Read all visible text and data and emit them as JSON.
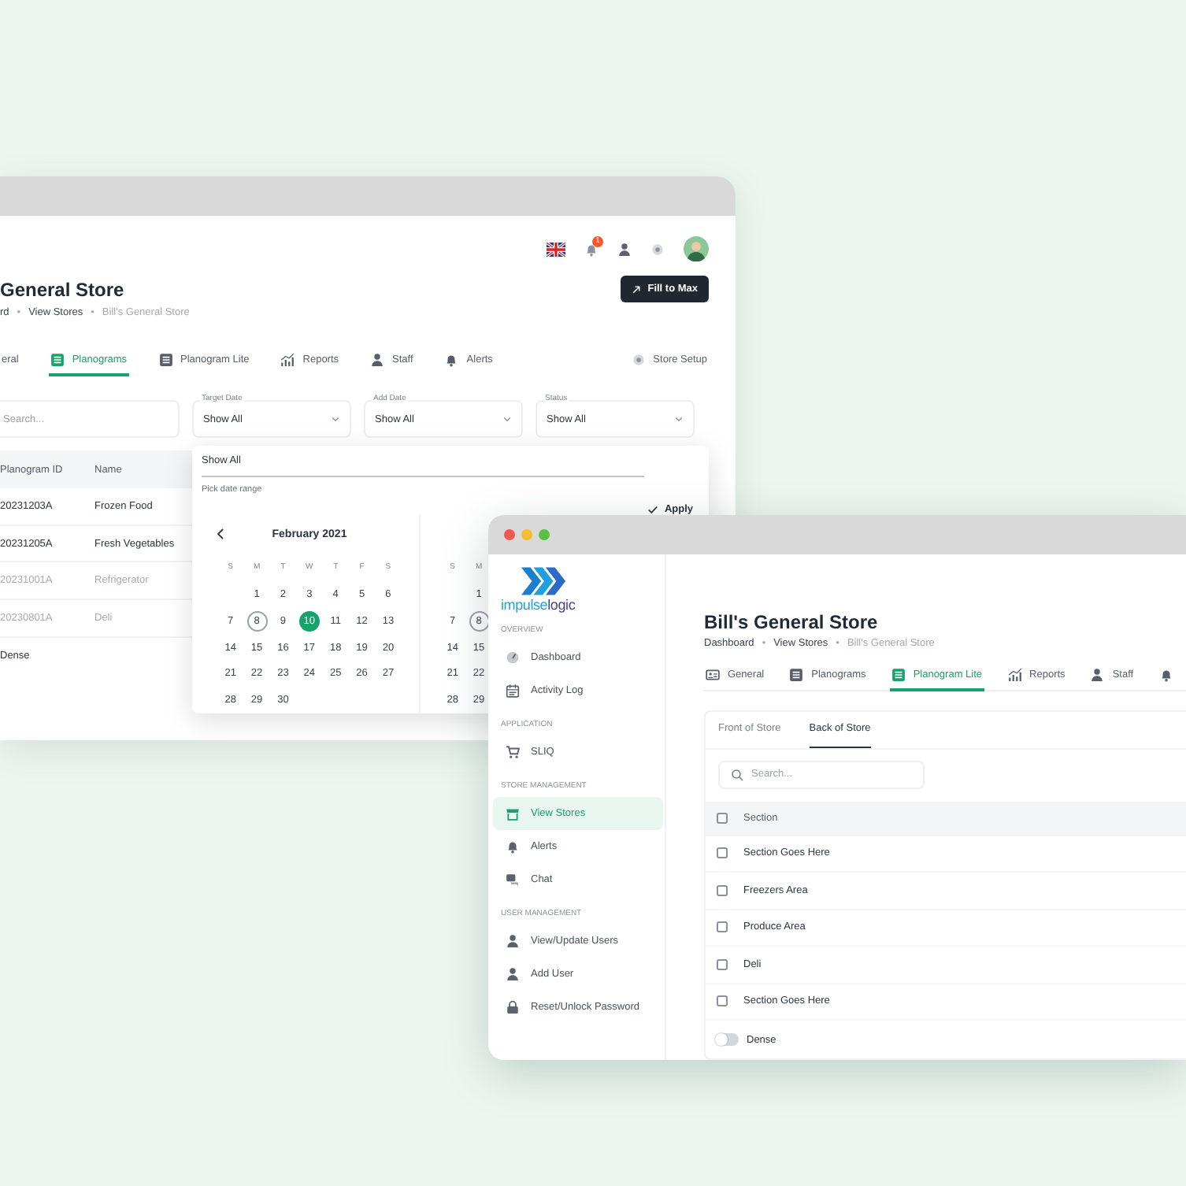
{
  "back_window": {
    "notification_count": "1",
    "title": "General Store",
    "fill_button": "Fill to Max",
    "breadcrumb": {
      "separator": "•",
      "items": [
        {
          "label": "rd",
          "current": false
        },
        {
          "label": "View Stores",
          "current": false
        },
        {
          "label": "Bill's General Store",
          "current": true
        }
      ]
    },
    "tabs": [
      {
        "label": "eral",
        "selected": false
      },
      {
        "label": "Planograms",
        "kind": "list",
        "selected": true
      },
      {
        "label": "Planogram Lite",
        "kind": "list",
        "selected": false
      },
      {
        "label": "Reports",
        "kind": "chart",
        "selected": false
      },
      {
        "label": "Staff",
        "kind": "person",
        "selected": false
      },
      {
        "label": "Alerts",
        "kind": "bell",
        "selected": false
      }
    ],
    "store_setup": "Store Setup",
    "search": {
      "placeholder": "Search..."
    },
    "filters": [
      {
        "label": "Target Date",
        "value": "Show All"
      },
      {
        "label": "Add Date",
        "value": "Show All"
      },
      {
        "label": "Status",
        "value": "Show All"
      }
    ],
    "table": {
      "columns": [
        "Planogram ID",
        "Name"
      ],
      "rows": [
        {
          "cells": [
            "20231203A",
            "Frozen Food"
          ],
          "muted": false
        },
        {
          "cells": [
            "20231205A",
            "Fresh Vegetables"
          ],
          "muted": false
        },
        {
          "cells": [
            "20231001A",
            "Refrigerator"
          ],
          "muted": true
        },
        {
          "cells": [
            "20230801A",
            "Deli"
          ],
          "muted": true
        }
      ]
    },
    "dense_label": "Dense",
    "date_popup": {
      "option": "Show All",
      "hint": "Pick date range",
      "apply": "Apply",
      "calendars": [
        {
          "month": "February 2021",
          "weekdays": [
            "S",
            "M",
            "T",
            "W",
            "T",
            "F",
            "S"
          ],
          "weeks": [
            {
              "days": [
                {
                  "day": "1",
                  "selected": false,
                  "today": false
                },
                {
                  "day": "2",
                  "selected": false,
                  "today": false
                },
                {
                  "day": "3",
                  "selected": false,
                  "today": false
                },
                {
                  "day": "4",
                  "selected": false,
                  "today": false
                },
                {
                  "day": "5",
                  "selected": false,
                  "today": false
                },
                {
                  "day": "6",
                  "selected": false,
                  "today": false
                }
              ]
            },
            {
              "days": [
                {
                  "day": "7",
                  "selected": false,
                  "today": false
                },
                {
                  "day": "8",
                  "selected": false,
                  "today": true
                },
                {
                  "day": "9",
                  "selected": false,
                  "today": false
                },
                {
                  "day": "10",
                  "selected": true,
                  "today": false
                },
                {
                  "day": "11",
                  "selected": false,
                  "today": false
                },
                {
                  "day": "12",
                  "selected": false,
                  "today": false
                },
                {
                  "day": "13",
                  "selected": false,
                  "today": false
                }
              ]
            },
            {
              "days": [
                {
                  "day": "14",
                  "selected": false,
                  "today": false
                },
                {
                  "day": "15",
                  "selected": false,
                  "today": false
                },
                {
                  "day": "16",
                  "selected": false,
                  "today": false
                },
                {
                  "day": "17",
                  "selected": false,
                  "today": false
                },
                {
                  "day": "18",
                  "selected": false,
                  "today": false
                },
                {
                  "day": "19",
                  "selected": false,
                  "today": false
                },
                {
                  "day": "20",
                  "selected": false,
                  "today": false
                }
              ]
            },
            {
              "days": [
                {
                  "day": "21",
                  "selected": false,
                  "today": false
                },
                {
                  "day": "22",
                  "selected": false,
                  "today": false
                },
                {
                  "day": "23",
                  "selected": false,
                  "today": false
                },
                {
                  "day": "24",
                  "selected": false,
                  "today": false
                },
                {
                  "day": "25",
                  "selected": false,
                  "today": false
                },
                {
                  "day": "26",
                  "selected": false,
                  "today": false
                },
                {
                  "day": "27",
                  "selected": false,
                  "today": false
                }
              ]
            },
            {
              "days": [
                {
                  "day": "28",
                  "selected": false,
                  "today": false
                },
                {
                  "day": "29",
                  "selected": false,
                  "today": false
                },
                {
                  "day": "30",
                  "selected": false,
                  "today": false
                }
              ]
            }
          ]
        },
        {
          "weekdays": [
            "S",
            "M"
          ],
          "weeks": [
            {
              "days": [
                {
                  "day": "1",
                  "selected": false,
                  "today": false
                }
              ]
            },
            {
              "days": [
                {
                  "day": "7",
                  "selected": false,
                  "today": false
                },
                {
                  "day": "8",
                  "selected": false,
                  "today": true
                }
              ]
            },
            {
              "days": [
                {
                  "day": "14",
                  "selected": false,
                  "today": false
                },
                {
                  "day": "15",
                  "selected": false,
                  "today": false
                }
              ]
            },
            {
              "days": [
                {
                  "day": "21",
                  "selected": false,
                  "today": false
                },
                {
                  "day": "22",
                  "selected": false,
                  "today": false
                }
              ]
            },
            {
              "days": [
                {
                  "day": "28",
                  "selected": false,
                  "today": false
                },
                {
                  "day": "29",
                  "selected": false,
                  "today": false
                }
              ]
            }
          ]
        }
      ]
    }
  },
  "front_window": {
    "logo": {
      "parts": [
        "impulse",
        "logic"
      ]
    },
    "sidebar": {
      "sections": [
        {
          "heading": "OVERVIEW",
          "items": [
            {
              "label": "Dashboard",
              "kind": "gauge",
              "selected": false
            },
            {
              "label": "Activity Log",
              "kind": "calendar",
              "selected": false
            }
          ]
        },
        {
          "heading": "APPLICATION",
          "items": [
            {
              "label": "SLIQ",
              "kind": "cart",
              "selected": false
            }
          ]
        },
        {
          "heading": "STORE MANAGEMENT",
          "items": [
            {
              "label": "View Stores",
              "kind": "store",
              "selected": true
            },
            {
              "label": "Alerts",
              "kind": "bell",
              "selected": false
            },
            {
              "label": "Chat",
              "kind": "chat",
              "selected": false
            }
          ]
        },
        {
          "heading": "USER MANAGEMENT",
          "items": [
            {
              "label": "View/Update Users",
              "kind": "person",
              "selected": false
            },
            {
              "label": "Add User",
              "kind": "person",
              "selected": false
            },
            {
              "label": "Reset/Unlock Password",
              "kind": "lock",
              "selected": false
            }
          ]
        }
      ]
    },
    "title": "Bill's General Store",
    "breadcrumb": {
      "separator": "•",
      "items": [
        {
          "label": "Dashboard",
          "current": false
        },
        {
          "label": "View Stores",
          "current": false
        },
        {
          "label": "Bill's General Store",
          "current": true
        }
      ]
    },
    "tabs": [
      {
        "label": "General",
        "kind": "card",
        "selected": false
      },
      {
        "label": "Planograms",
        "kind": "list",
        "selected": false
      },
      {
        "label": "Planogram Lite",
        "kind": "list",
        "selected": true
      },
      {
        "label": "Reports",
        "kind": "chart",
        "selected": false
      },
      {
        "label": "Staff",
        "kind": "person",
        "selected": false
      },
      {
        "kind": "bell",
        "selected": false
      }
    ],
    "subtabs": [
      {
        "label": "Front of Store",
        "selected": false
      },
      {
        "label": "Back of Store",
        "selected": true
      }
    ],
    "search": {
      "placeholder": "Search..."
    },
    "table": {
      "column": "Section",
      "all_checked": false,
      "rows": [
        {
          "section": "Section Goes Here",
          "checked": false
        },
        {
          "section": "Freezers Area",
          "checked": false
        },
        {
          "section": "Produce Area",
          "checked": false
        },
        {
          "section": "Deli",
          "checked": false
        },
        {
          "section": "Section Goes Here",
          "checked": false
        }
      ]
    },
    "dense": {
      "label": "Dense",
      "on": false
    }
  }
}
